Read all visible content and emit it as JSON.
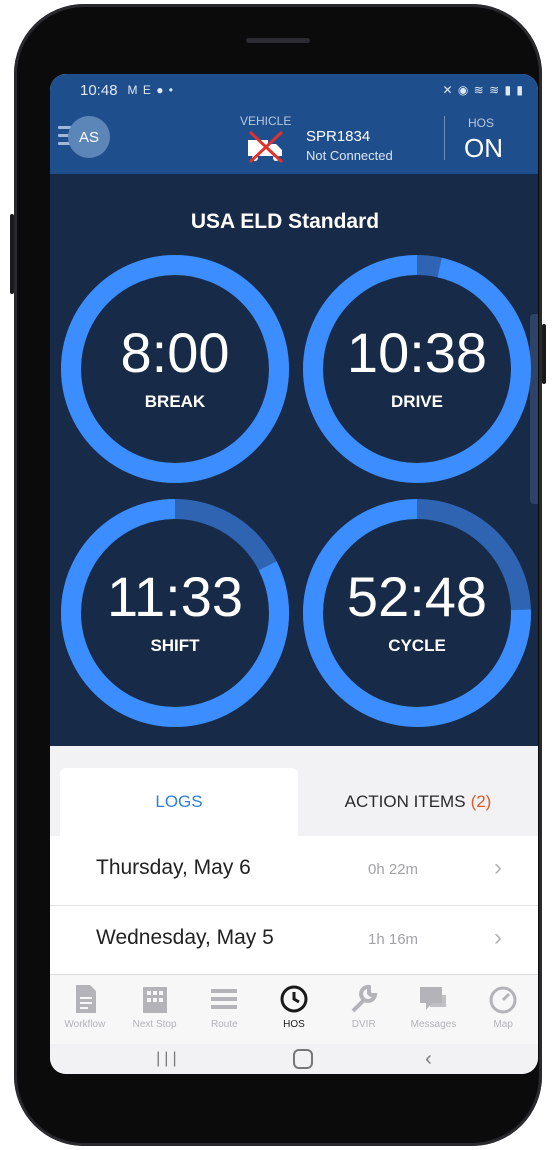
{
  "status_bar": {
    "time": "10:48",
    "icons_left": "M E ● •",
    "icons_right": "✕ ◉ ≋ ≋ ▮ ▮"
  },
  "header": {
    "avatar_initials": "AS",
    "vehicle_label": "VEHICLE",
    "vehicle_id": "SPR1834",
    "vehicle_status": "Not Connected",
    "hos_label": "HOS",
    "hos_value": "ON"
  },
  "dashboard": {
    "ruleset": "USA ELD Standard",
    "gauges": [
      {
        "name": "break",
        "time": "8:00",
        "label": "BREAK",
        "remaining_fraction": 1.0
      },
      {
        "name": "drive",
        "time": "10:38",
        "label": "DRIVE",
        "remaining_fraction": 0.965
      },
      {
        "name": "shift",
        "time": "11:33",
        "label": "SHIFT",
        "remaining_fraction": 0.825
      },
      {
        "name": "cycle",
        "time": "52:48",
        "label": "CYCLE",
        "remaining_fraction": 0.755
      }
    ],
    "colors": {
      "ring_track": "#2f64b3",
      "ring_fill": "#3c8dff",
      "background": "#172a47"
    }
  },
  "tabs": {
    "logs": "LOGS",
    "action_items": "ACTION ITEMS",
    "action_items_count": "(2)"
  },
  "logs": [
    {
      "day": "Thursday, May 6",
      "duration": "0h 22m"
    },
    {
      "day": "Wednesday, May 5",
      "duration": "1h 16m"
    }
  ],
  "nav": {
    "workflow": "Workflow",
    "next_stop": "Next Stop",
    "route": "Route",
    "hos": "HOS",
    "dvir": "DVIR",
    "messages": "Messages",
    "map": "Map"
  },
  "colors": {
    "header_blue": "#1e4f8c",
    "accent_blue": "#2f7fe0",
    "badge_orange": "#e05a2a"
  }
}
